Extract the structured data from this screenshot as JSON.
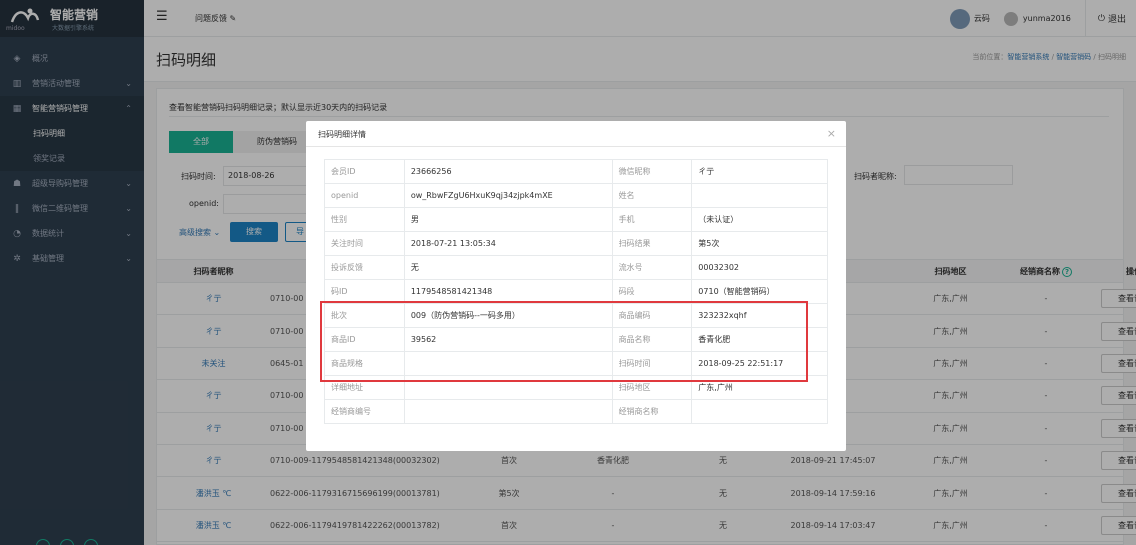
{
  "sidebar": {
    "brand": "智能营销",
    "tagline": "大数据引擎系统",
    "brand_small": "midoo",
    "items": [
      {
        "icon": "layers-icon",
        "label": "概况"
      },
      {
        "icon": "bar-chart-icon",
        "label": "营销活动管理"
      },
      {
        "icon": "qrcode-icon",
        "label": "智能营销码管理"
      },
      {
        "label": "扫码明细"
      },
      {
        "label": "领奖记录"
      },
      {
        "icon": "users-icon",
        "label": "超级导购码管理"
      },
      {
        "icon": "barcode-icon",
        "label": "微信二维码管理"
      },
      {
        "icon": "pie-chart-icon",
        "label": "数据统计"
      },
      {
        "icon": "gear-icon",
        "label": "基础管理"
      }
    ]
  },
  "topbar": {
    "feedback": "问题反馈",
    "cloud": "云码",
    "user": "yunma2016",
    "logout": "退出"
  },
  "header": {
    "title": "扫码明细",
    "crumb_prefix": "当前位置：",
    "crumb1": "智能营销系统",
    "crumb2": "智能营销码",
    "crumb3": "扫码明细"
  },
  "notice": "查看智能营销码扫码明细记录；默认显示近30天内的扫码记录",
  "tabs": [
    "全部",
    "防伪营销码"
  ],
  "filters": {
    "time_label": "扫码时间:",
    "time_value": "2018-08-26",
    "openid_label": "openid:",
    "nick_label": "扫码者昵称:",
    "advanced": "高级搜索",
    "search": "搜索",
    "export": "导"
  },
  "table": {
    "headers": [
      "扫码者昵称",
      "",
      "",
      "",
      "",
      "",
      "扫码地区",
      "经销商名称",
      "操作"
    ],
    "rows": [
      {
        "nick": "ㄔ亍",
        "code": "0710-00",
        "times": "",
        "product": "",
        "res": "",
        "time": "",
        "area": "广东,广州",
        "dealer": "-",
        "btn": "查看详情"
      },
      {
        "nick": "ㄔ亍",
        "code": "0710-00",
        "times": "",
        "product": "",
        "res": "",
        "time": "",
        "area": "广东,广州",
        "dealer": "-",
        "btn": "查看详情"
      },
      {
        "nick": "未关注",
        "code": "0645-01",
        "times": "",
        "product": "",
        "res": "",
        "time": "",
        "area": "广东,广州",
        "dealer": "-",
        "btn": "查看详情"
      },
      {
        "nick": "ㄔ亍",
        "code": "0710-00",
        "times": "",
        "product": "",
        "res": "",
        "time": "",
        "area": "广东,广州",
        "dealer": "-",
        "btn": "查看详情"
      },
      {
        "nick": "ㄔ亍",
        "code": "0710-00",
        "times": "",
        "product": "",
        "res": "",
        "time": "",
        "area": "广东,广州",
        "dealer": "-",
        "btn": "查看详情"
      },
      {
        "nick": "ㄔ亍",
        "code": "0710-009-1179548581421348(00032302)",
        "times": "首次",
        "product": "香青化肥",
        "res": "无",
        "time": "2018-09-21 17:45:07",
        "area": "广东,广州",
        "dealer": "-",
        "btn": "查看详情"
      },
      {
        "nick": "潘洪玉 ℃",
        "code": "0622-006-1179316715696199(00013781)",
        "times": "第5次",
        "product": "-",
        "res": "无",
        "time": "2018-09-14 17:59:16",
        "area": "广东,广州",
        "dealer": "-",
        "btn": "查看详情"
      },
      {
        "nick": "潘洪玉 ℃",
        "code": "0622-006-1179419781422262(00013782)",
        "times": "首次",
        "product": "-",
        "res": "无",
        "time": "2018-09-14 17:03:47",
        "area": "广东,广州",
        "dealer": "-",
        "btn": "查看详情"
      }
    ]
  },
  "modal": {
    "title": "扫码明细详情",
    "close": "×",
    "rows": [
      [
        "会员ID",
        "23666256",
        "微信昵称",
        "ㄔ亍"
      ],
      [
        "openid",
        "ow_RbwFZgU6HxuK9qj34zjpk4mXE",
        "姓名",
        ""
      ],
      [
        "性别",
        "男",
        "手机",
        "（未认证）"
      ],
      [
        "关注时间",
        "2018-07-21 13:05:34",
        "扫码结果",
        "第5次"
      ],
      [
        "投诉反馈",
        "无",
        "流水号",
        "00032302"
      ],
      [
        "码ID",
        "1179548581421348",
        "码段",
        "0710（智能营销码）"
      ],
      [
        "批次",
        "009（防伪营销码--一码多用）",
        "商品编码",
        "323232xqhf"
      ],
      [
        "商品ID",
        "39562",
        "商品名称",
        "香青化肥"
      ],
      [
        "商品规格",
        "",
        "扫码时间",
        "2018-09-25 22:51:17"
      ],
      [
        "详细地址",
        "",
        "扫码地区",
        "广东,广州"
      ],
      [
        "经销商编号",
        "",
        "经销商名称",
        ""
      ]
    ]
  },
  "colors": {
    "sidebar": "#2f4050",
    "accent": "#1ab394",
    "primary": "#1c84c6",
    "highlight": "#e0393e"
  }
}
